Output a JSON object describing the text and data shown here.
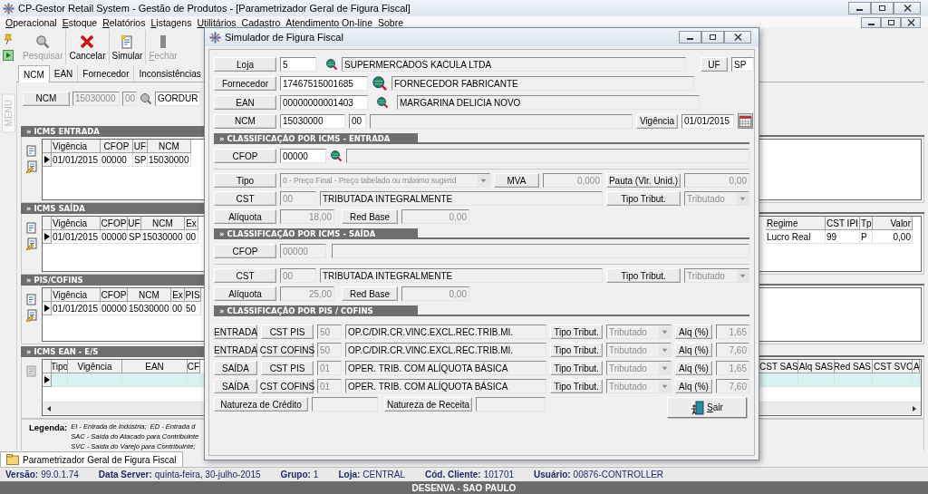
{
  "window": {
    "title": "CP-Gestor Retail System - Gestão de Produtos - [Parametrizador Geral de Figura Fiscal]"
  },
  "menu": [
    "Operacional",
    "Estoque",
    "Relatórios",
    "Listagens",
    "Utilitários",
    "Cadastro",
    "Atendimento On-line",
    "Sobre"
  ],
  "side_tab": "MENU",
  "toolbar": [
    {
      "label": "Pesquisar",
      "disabled": true
    },
    {
      "label": "Cancelar",
      "disabled": false
    },
    {
      "label": "Simular",
      "disabled": false
    },
    {
      "label": "Fechar",
      "disabled": true
    }
  ],
  "tabs": [
    {
      "label": "NCM",
      "selected": true
    },
    {
      "label": "EAN",
      "selected": false
    },
    {
      "label": "Fornecedor",
      "selected": false
    },
    {
      "label": "Inconsistências",
      "selected": false
    }
  ],
  "ncm_filter": {
    "label": "NCM",
    "code": "15030000",
    "ex": "00",
    "description": "GORDUR"
  },
  "sections": [
    {
      "title": "» ICMS ENTRADA",
      "columns": [
        "Vigência",
        "CFOP",
        "UF",
        "NCM"
      ],
      "rows": [
        {
          "cells": [
            "01/01/2015",
            "00000",
            "SP",
            "15030000"
          ],
          "selected": false
        }
      ]
    },
    {
      "title": "» ICMS SAÍDA",
      "columns": [
        "Vigência",
        "CFOP",
        "UF",
        "NCM",
        "Ex"
      ],
      "right_columns": [
        "Regime",
        "CST IPI",
        "Tp",
        "Valor"
      ],
      "rows": [
        {
          "cells": [
            "01/01/2015",
            "00000",
            "SP",
            "15030000",
            "00"
          ],
          "right_cells": [
            "Lucro Real",
            "99",
            "P",
            "0,00"
          ],
          "selected": false
        }
      ]
    },
    {
      "title": "» PIS/COFINS",
      "columns": [
        "Vigência",
        "CFOP",
        "NCM",
        "Ex",
        "PIS"
      ],
      "rows": [
        {
          "cells": [
            "01/01/2015",
            "00000",
            "15030000",
            "00",
            "50"
          ],
          "selected": false
        }
      ]
    },
    {
      "title": "» ICMS EAN - E/S",
      "columns": [
        "Tipo",
        "Vigência",
        "EAN",
        "CF"
      ],
      "right_columns": [
        "CST SAS",
        "Alq SAS",
        "Red SAS",
        "CST SVC",
        "A"
      ],
      "rows": [
        {
          "selected": true
        }
      ]
    }
  ],
  "legend": {
    "title": "Legenda:",
    "lines": [
      "EI - Entrada de Indústria;  ED - Entrada d",
      "SAC - Saída do Atacado para Contribuinte",
      "SVC - Saída do Varejo para Contribuinte;"
    ]
  },
  "task_tab": {
    "label": "Parametrizador Geral de Figura Fiscal"
  },
  "status_bar": [
    {
      "label": "Versão:",
      "value": "99.0.1.74"
    },
    {
      "label": "Data Server:",
      "value": "quinta-feira, 30-julho-2015"
    },
    {
      "label": "Grupo:",
      "value": "1"
    },
    {
      "label": "Loja:",
      "value": "CENTRAL"
    },
    {
      "label": "Cód. Cliente:",
      "value": "101701"
    },
    {
      "label": "Usuário:",
      "value": "00876-CONTROLLER"
    }
  ],
  "footer": "DESENVA - SAO PAULO",
  "dialog": {
    "title": "Simulador de Figura Fiscal",
    "loja": {
      "label": "Loja",
      "code": "5",
      "name": "SUPERMERCADOS KACULA LTDA",
      "uf_label": "UF",
      "uf": "SP"
    },
    "fornecedor": {
      "label": "Fornecedor",
      "code": "17467515001685",
      "name": "FORNECEDOR FABRICANTE"
    },
    "ean": {
      "label": "EAN",
      "code": "00000000001403",
      "name": "MARGARINA DELICIA NOVO"
    },
    "ncm": {
      "label": "NCM",
      "code": "15030000",
      "ex": "00",
      "vigencia_label": "Vigência",
      "vigencia": "01/01/2015"
    },
    "entrada": {
      "title": "» CLASSIFICAÇÃO POR ICMS - ENTRADA",
      "cfop_label": "CFOP",
      "cfop": "00000",
      "cfop_disabled": false,
      "tipo_label": "Tipo",
      "tipo": "0 - Preço Final - Preço tabelado ou máximo sugerid",
      "mva_label": "MVA",
      "mva": "0,000",
      "pauta_label": "Pauta (Vlr. Unid.)",
      "pauta": "0,00",
      "cst_label": "CST",
      "cst": "00",
      "cst_desc": "TRIBUTADA INTEGRALMENTE",
      "tipo_tribut_label": "Tipo Tribut.",
      "tipo_tribut": "Tributado",
      "aliquota_label": "Alíquota",
      "aliquota": "18,00",
      "red_base_label": "Red Base",
      "red_base": "0,00"
    },
    "saida": {
      "title": "» CLASSIFICAÇÃO POR ICMS - SAÍDA",
      "cfop_label": "CFOP",
      "cfop": "00000",
      "cfop_disabled": true,
      "cst_label": "CST",
      "cst": "00",
      "cst_desc": "TRIBUTADA INTEGRALMENTE",
      "tipo_tribut_label": "Tipo Tribut.",
      "tipo_tribut": "Tributado",
      "aliquota_label": "Alíquota",
      "aliquota": "25,00",
      "red_base_label": "Red Base",
      "red_base": "0,00"
    },
    "pis_cofins": {
      "title": "» CLASSIFICAÇÃO POR PIS / COFINS",
      "rows": [
        {
          "direction": "ENTRADA",
          "cst_label": "CST PIS",
          "cst": "50",
          "description": "OP.C/DIR.CR.VINC.EXCL.REC.TRIB.MI.",
          "tipo_tribut_label": "Tipo Tribut.",
          "tipo_tribut": "Tributado",
          "alq_label": "Alq (%)",
          "alq": "1,65"
        },
        {
          "direction": "ENTRADA",
          "cst_label": "CST COFINS",
          "cst": "50",
          "description": "OP.C/DIR.CR.VINC.EXCL.REC.TRIB.MI.",
          "tipo_tribut_label": "Tipo Tribut.",
          "tipo_tribut": "Tributado",
          "alq_label": "Alq (%)",
          "alq": "7,60"
        },
        {
          "direction": "SAÍDA",
          "cst_label": "CST PIS",
          "cst": "01",
          "description": "OPER. TRIB. COM ALÍQUOTA BÁSICA",
          "tipo_tribut_label": "Tipo Tribut.",
          "tipo_tribut": "Tributado",
          "alq_label": "Alq (%)",
          "alq": "1,65"
        },
        {
          "direction": "SAÍDA",
          "cst_label": "CST COFINS",
          "cst": "01",
          "description": "OPER. TRIB. COM ALÍQUOTA BÁSICA",
          "tipo_tribut_label": "Tipo Tribut.",
          "tipo_tribut": "Tributado",
          "alq_label": "Alq (%)",
          "alq": "7,60"
        }
      ],
      "natureza_credito_label": "Natureza de Crédito",
      "natureza_receita_label": "Natureza de Receita"
    },
    "exit_button": "Sair"
  }
}
